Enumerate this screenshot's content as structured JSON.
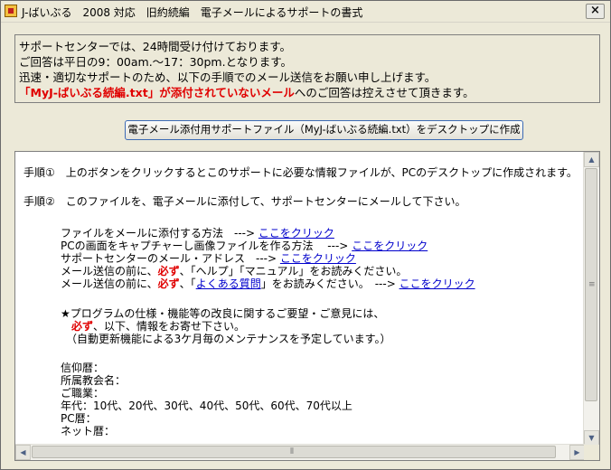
{
  "window": {
    "title": "J-ばいぶる　2008 対応　旧約続編　電子メールによるサポートの書式",
    "close_label": "×"
  },
  "info": {
    "line1": "サポートセンターでは、24時間受け付けております。",
    "line2": "ご回答は平日の9：00am.～17：30pm.となります。",
    "line3": "迅速・適切なサポートのため、以下の手順でのメール送信をお願い申し上げます。",
    "line4_red": "「MyJ-ばいぶる続編.txt」が添付されていないメール",
    "line4_rest": "へのご回答は控えさせて頂きます。"
  },
  "create_button_label": "電子メール添付用サポートファイル（MyJ-ばいぶる続編.txt）をデスクトップに作成",
  "doc": {
    "step1": "手順①　上のボタンをクリックするとこのサポートに必要な情報ファイルが、PCのデスクトップに作成されます。",
    "step2": "手順②　このファイルを、電子メールに添付して、サポートセンターにメールして下さい。",
    "attach_text": "ファイルをメールに添付する方法　--->",
    "attach_link": "ここをクリック",
    "capture_text": "PCの画面をキャプチャーし画像ファイルを作る方法　 --->",
    "capture_link": "ここをクリック",
    "address_text": "サポートセンターのメール・アドレス　--->",
    "address_link": "ここをクリック",
    "help_pre": "メール送信の前に、",
    "help_must": "必ず",
    "help_post": "、「ヘルプ」「マニュアル」をお読みください。",
    "faq_pre": "メール送信の前に、",
    "faq_must": "必ず",
    "faq_mid1": "、「",
    "faq_link_text": "よくある質問",
    "faq_mid2": "」をお読みください。　--->",
    "faq_link": "ここをクリック",
    "request_head": "★プログラムの仕様・機能等の改良に関するご要望・ご意見には、",
    "request_must": "必ず",
    "request_rest": "、以下、情報をお寄せ下さい。",
    "request_note": "（自動更新機能による3ケ月毎のメンテナンスを予定しています。）",
    "field_faith": "信仰暦：",
    "field_church": "所属教会名：",
    "field_job": "ご職業：",
    "field_age": "年代：10代、20代、30代、40代、50代、60代、70代以上",
    "field_pc": "PC暦：",
    "field_net": "ネット暦："
  },
  "colors": {
    "accent_red": "#e00000",
    "link_blue": "#0000cc",
    "face": "#ece9d8"
  }
}
